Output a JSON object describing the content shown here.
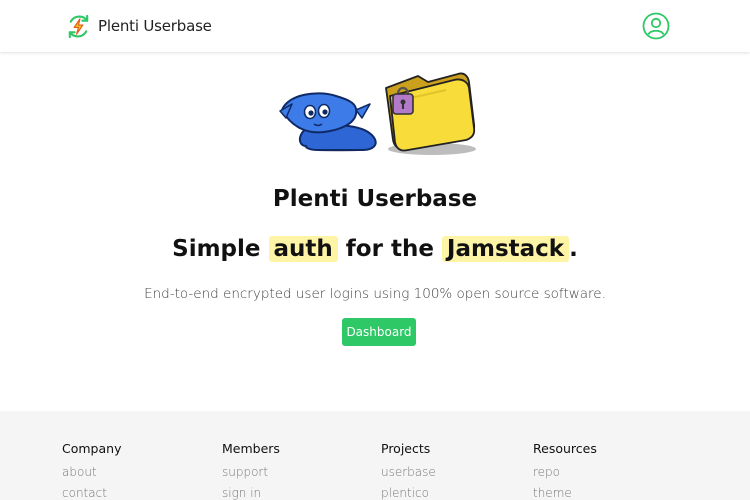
{
  "header": {
    "brand_name": "Plenti Userbase",
    "logo_icon": "lightning-refresh-icon",
    "user_icon": "user-circle-icon",
    "accent_color": "#2ec866"
  },
  "hero": {
    "title": "Plenti Userbase",
    "tagline_pre": "Simple ",
    "tagline_hl1": "auth",
    "tagline_mid": " for the ",
    "tagline_hl2": "Jamstack",
    "tagline_post": ".",
    "subtitle": "End-to-end encrypted user logins using 100% open source software.",
    "cta_label": "Dashboard",
    "highlight_color": "#fdf4a6"
  },
  "footer": {
    "columns": [
      {
        "heading": "Company",
        "links": [
          "about",
          "contact"
        ]
      },
      {
        "heading": "Members",
        "links": [
          "support",
          "sign in"
        ]
      },
      {
        "heading": "Projects",
        "links": [
          "userbase",
          "plentico"
        ]
      },
      {
        "heading": "Resources",
        "links": [
          "repo",
          "theme"
        ]
      }
    ]
  }
}
